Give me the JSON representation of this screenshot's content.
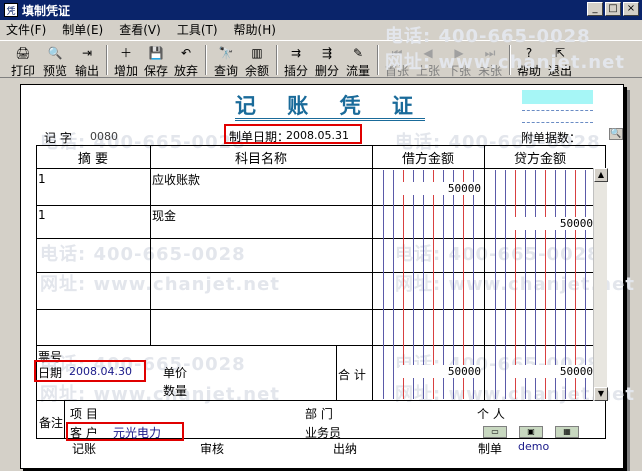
{
  "window": {
    "title": "填制凭证",
    "min": "_",
    "max": "□",
    "close": "×"
  },
  "menu": [
    "文件(F)",
    "制单(E)",
    "查看(V)",
    "工具(T)",
    "帮助(H)"
  ],
  "toolbar": [
    {
      "label": "打印",
      "icon": "🖨",
      "name": "print"
    },
    {
      "label": "预览",
      "icon": "🔍",
      "name": "preview"
    },
    {
      "label": "输出",
      "icon": "⇥",
      "name": "export"
    },
    {
      "label": "增加",
      "icon": "＋",
      "name": "add"
    },
    {
      "label": "保存",
      "icon": "💾",
      "name": "save"
    },
    {
      "label": "放弃",
      "icon": "↶",
      "name": "discard"
    },
    {
      "label": "查询",
      "icon": "🔭",
      "name": "query"
    },
    {
      "label": "余额",
      "icon": "▥",
      "name": "balance"
    },
    {
      "label": "插分",
      "icon": "⇉",
      "name": "insert-entry"
    },
    {
      "label": "删分",
      "icon": "⇶",
      "name": "delete-entry"
    },
    {
      "label": "流量",
      "icon": "✎",
      "name": "cashflow"
    },
    {
      "label": "首张",
      "icon": "⏮",
      "name": "first"
    },
    {
      "label": "上张",
      "icon": "◀",
      "name": "prev"
    },
    {
      "label": "下张",
      "icon": "▶",
      "name": "next"
    },
    {
      "label": "末张",
      "icon": "⏭",
      "name": "last"
    },
    {
      "label": "帮助",
      "icon": "?",
      "name": "help"
    },
    {
      "label": "退出",
      "icon": "⇱",
      "name": "exit"
    }
  ],
  "voucher": {
    "heading": "记 账 凭 证",
    "type_label": "记  字",
    "number": "0080",
    "date_label": "制单日期：",
    "date": "2008.05.31",
    "attachments_label": "附单据数：",
    "columns": {
      "summary": "摘  要",
      "account": "科目名称",
      "debit": "借方金额",
      "credit": "贷方金额"
    },
    "rows": [
      {
        "summary": "1",
        "account": "应收账款",
        "debit": "50000",
        "credit": ""
      },
      {
        "summary": "1",
        "account": "现金",
        "debit": "",
        "credit": "50000"
      }
    ],
    "ticket_label": "票号",
    "ticket_date_label": "日期",
    "ticket_date": "2008.04.30",
    "unit_price_label": "单价",
    "quantity_label": "数量",
    "total_label": "合  计",
    "total_debit": "50000",
    "total_credit": "50000",
    "remark_label": "备注",
    "project_label": "项    目",
    "department_label": "部    门",
    "person_label": "个    人",
    "customer_label": "客    户",
    "customer_value": "元光电力",
    "salesperson_label": "业务员"
  },
  "footer": {
    "bookkeeper": "记账",
    "reviewer": "审核",
    "cashier": "出纳",
    "maker_label": "制单",
    "maker": "demo"
  },
  "watermark": {
    "phone": "电话: 400-665-0028",
    "site": "网址: www.chanjet.net"
  }
}
